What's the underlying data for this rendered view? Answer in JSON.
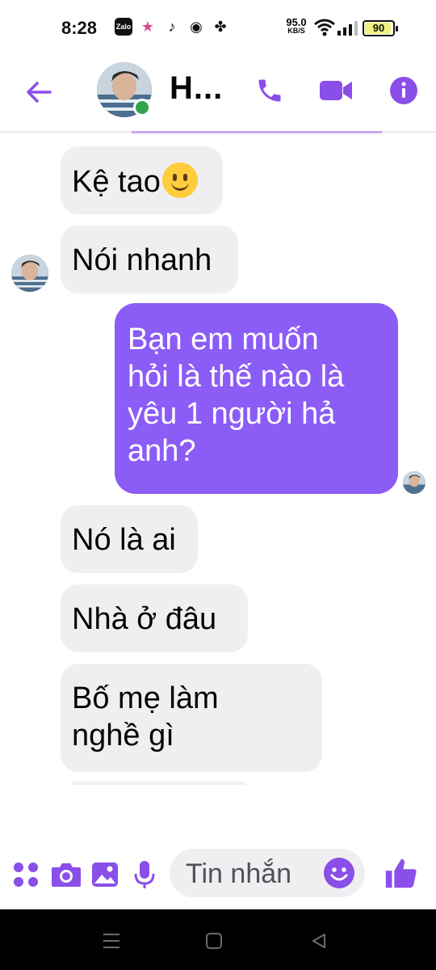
{
  "status_bar": {
    "time": "8:28",
    "app_icons": [
      "zalo-icon",
      "star-icon",
      "tiktok-icon",
      "chrome-icon",
      "pinwheel-icon"
    ],
    "zalo_label": "Zalo",
    "net_speed_value": "95.0",
    "net_speed_unit": "KB/S",
    "battery_level": "90",
    "battery_fraction": 0.9
  },
  "header": {
    "contact_name": "H...",
    "online_status_color": "#31a24c",
    "accent_color": "#8b5cf6"
  },
  "messages": [
    {
      "direction": "incoming",
      "text": "Kệ tao",
      "emoji": "slightly-smiling-face-emoji"
    },
    {
      "direction": "incoming",
      "text": "Nói nhanh"
    },
    {
      "direction": "outgoing",
      "lines": [
        "Bạn em muốn",
        "hỏi là thế nào là",
        "yêu 1 người hả",
        "anh?"
      ]
    },
    {
      "direction": "incoming",
      "text": "Nó là ai"
    },
    {
      "direction": "incoming",
      "text": "Nhà ở đâu"
    },
    {
      "direction": "incoming",
      "lines": [
        "Bố mẹ làm",
        "nghề gì"
      ]
    }
  ],
  "composer": {
    "placeholder": "Tin nhắn",
    "icons": [
      "apps-grid-icon",
      "camera-icon",
      "gallery-icon",
      "microphone-icon",
      "emoji-icon",
      "thumbs-up-icon"
    ]
  },
  "nav_bar": {
    "icons": [
      "menu-icon",
      "home-icon",
      "back-icon"
    ]
  },
  "colors": {
    "outgoing_bubble": "#8b5cf6",
    "incoming_bubble": "#efeff2",
    "icon_purple": "#8a4fe8"
  }
}
